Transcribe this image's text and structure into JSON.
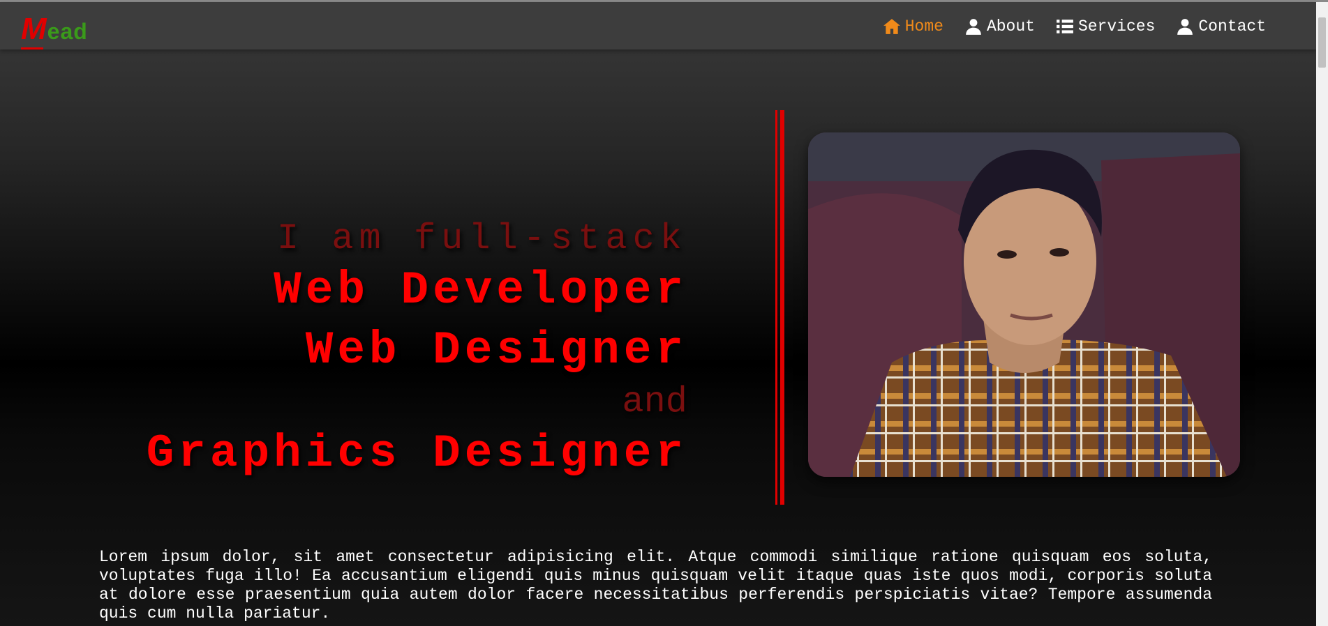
{
  "logo": {
    "first_letter": "M",
    "rest": "ead"
  },
  "nav": {
    "items": [
      {
        "label": "Home",
        "icon": "home-icon",
        "active": true
      },
      {
        "label": "About",
        "icon": "user-icon",
        "active": false
      },
      {
        "label": "Services",
        "icon": "list-icon",
        "active": false
      },
      {
        "label": "Contact",
        "icon": "user-icon",
        "active": false
      }
    ]
  },
  "hero": {
    "intro": "I am full-stack",
    "role1": "Web Developer",
    "role2": "Web Designer",
    "conjunction": "and",
    "role3": "Graphics Designer"
  },
  "bio": {
    "text": "Lorem ipsum dolor, sit amet consectetur adipisicing elit. Atque commodi similique ratione quisquam eos soluta, voluptates fuga illo! Ea accusantium eligendi quis minus quisquam velit itaque quas iste quos modi, corporis soluta at dolore esse praesentium quia autem dolor facere necessitatibus perferendis perspiciatis vitae? Tempore assumenda quis cum nulla pariatur."
  },
  "colors": {
    "accent_red": "#ff0000",
    "active_nav": "#f08a1a",
    "logo_green": "#3a9a1a"
  }
}
